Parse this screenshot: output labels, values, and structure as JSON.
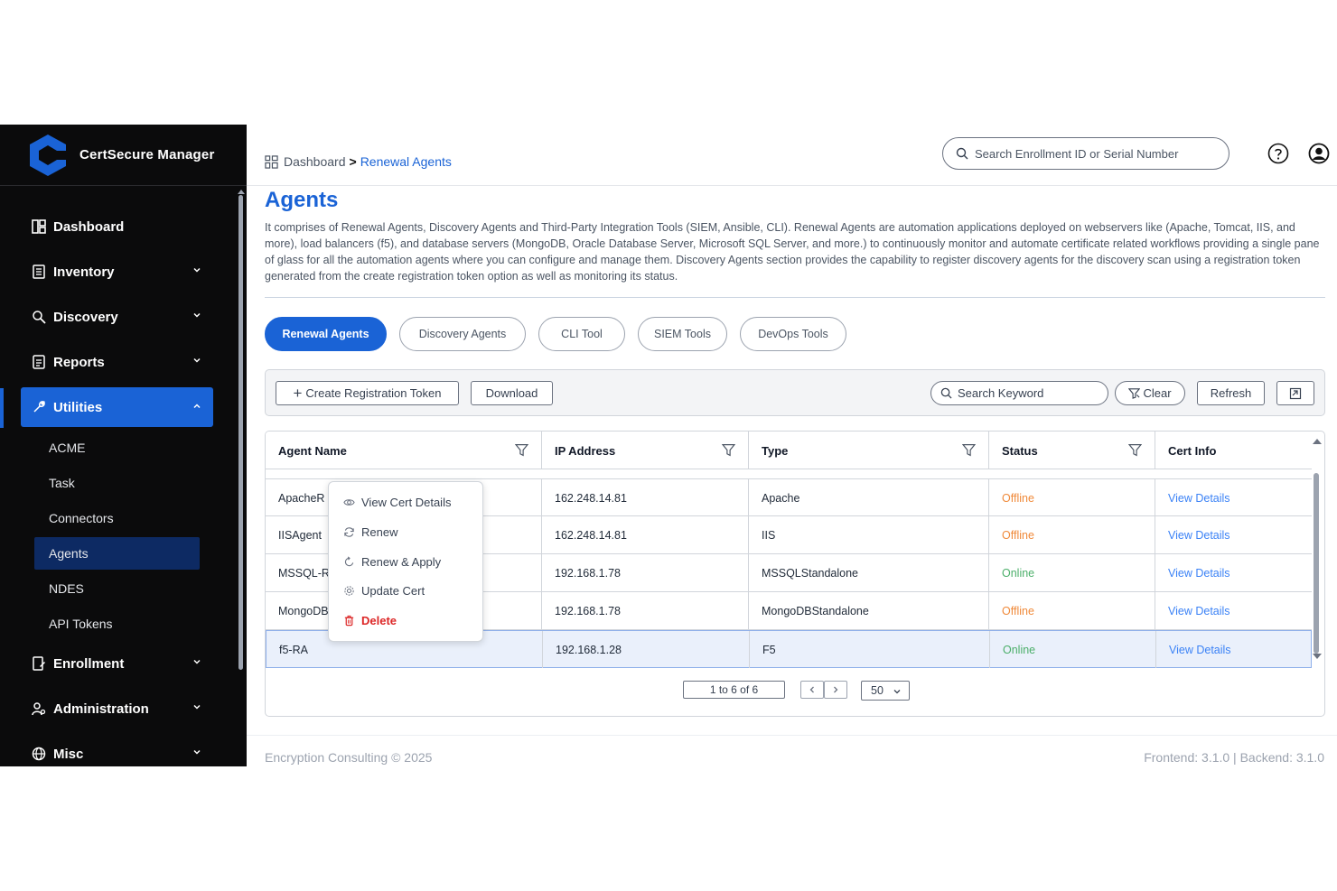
{
  "app": {
    "name": "CertSecure Manager"
  },
  "sidebar": {
    "items": [
      {
        "label": "Dashboard",
        "icon": "dashboard-icon"
      },
      {
        "label": "Inventory",
        "icon": "inventory-icon"
      },
      {
        "label": "Discovery",
        "icon": "discovery-icon"
      },
      {
        "label": "Reports",
        "icon": "reports-icon"
      },
      {
        "label": "Utilities",
        "icon": "wrench-icon",
        "expanded": true
      },
      {
        "label": "Enrollment",
        "icon": "enrollment-icon"
      },
      {
        "label": "Administration",
        "icon": "administration-icon"
      },
      {
        "label": "Misc",
        "icon": "globe-icon"
      }
    ],
    "utilities_sub": [
      "ACME",
      "Task",
      "Connectors",
      "Agents",
      "NDES",
      "API Tokens"
    ],
    "selected_sub": "Agents"
  },
  "topbar": {
    "breadcrumb_root": "Dashboard",
    "breadcrumb_sep": ">",
    "breadcrumb_current": "Renewal Agents",
    "search_placeholder": "Search Enrollment ID or Serial Number"
  },
  "page": {
    "title": "Agents",
    "description": "It comprises of Renewal Agents, Discovery Agents and Third-Party Integration Tools (SIEM, Ansible, CLI). Renewal Agents are automation applications deployed on webservers like (Apache, Tomcat, IIS, and more), load balancers (f5), and database servers (MongoDB, Oracle Database Server, Microsoft SQL Server, and more.) to continuously monitor and automate certificate related workflows providing a single pane of glass for all the automation agents where you can configure and manage them. Discovery Agents section provides the capability to register discovery agents for the discovery scan using a registration token generated from the create registration token option as well as monitoring its status."
  },
  "tabs": [
    "Renewal Agents",
    "Discovery Agents",
    "CLI Tool",
    "SIEM Tools",
    "DevOps Tools"
  ],
  "active_tab": "Renewal Agents",
  "toolbar": {
    "create_label": "Create Registration Token",
    "download_label": "Download",
    "search_placeholder": "Search Keyword",
    "clear_label": "Clear",
    "refresh_label": "Refresh"
  },
  "table": {
    "columns": [
      "Agent Name",
      "IP Address",
      "Type",
      "Status",
      "Cert Info"
    ],
    "rows": [
      {
        "agent": "ApacheR",
        "ip": "162.248.14.81",
        "type": "Apache",
        "status": "Offline",
        "cert": "View Details"
      },
      {
        "agent": "IISAgent",
        "ip": "162.248.14.81",
        "type": "IIS",
        "status": "Offline",
        "cert": "View Details"
      },
      {
        "agent": "MSSQL-R",
        "ip": "192.168.1.78",
        "type": "MSSQLStandalone",
        "status": "Online",
        "cert": "View Details"
      },
      {
        "agent": "MongoDB",
        "ip": "192.168.1.78",
        "type": "MongoDBStandalone",
        "status": "Offline",
        "cert": "View Details"
      },
      {
        "agent": "f5-RA",
        "ip": "192.168.1.28",
        "type": "F5",
        "status": "Online",
        "cert": "View Details"
      }
    ]
  },
  "pagination": {
    "summary": "1 to 6 of 6",
    "page_size": "50"
  },
  "context_menu": {
    "items": [
      {
        "label": "View Cert Details",
        "icon": "eye-icon"
      },
      {
        "label": "Renew",
        "icon": "refresh-icon"
      },
      {
        "label": "Renew & Apply",
        "icon": "renew-apply-icon"
      },
      {
        "label": "Update Cert",
        "icon": "gear-icon"
      },
      {
        "label": "Delete",
        "icon": "trash-icon"
      }
    ]
  },
  "footer": {
    "copyright": "Encryption Consulting © 2025",
    "versions": "Frontend: 3.1.0  |  Backend: 3.1.0"
  },
  "colors": {
    "accent": "#1a63d6",
    "sidebar_bg": "#0b0b0c",
    "offline": "#f08a3a",
    "online": "#4caf6a",
    "link": "#3b82f6",
    "danger": "#dc2626"
  }
}
